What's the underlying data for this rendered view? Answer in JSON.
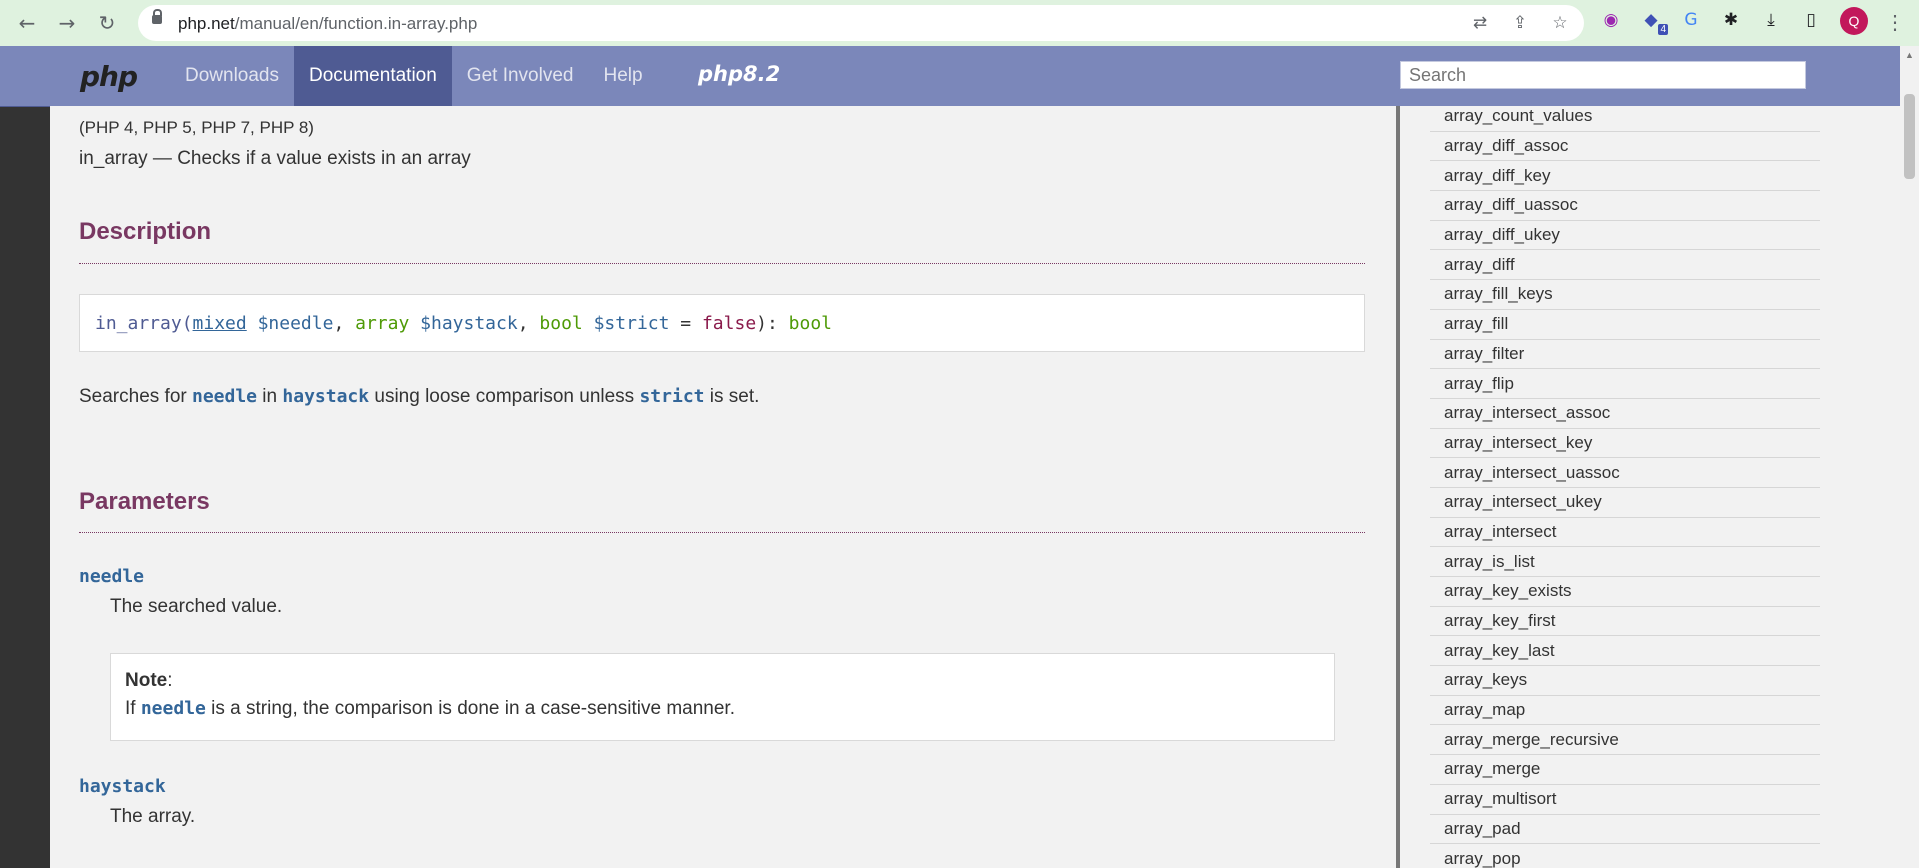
{
  "browser": {
    "url_host": "php.net",
    "url_path": "/manual/en/function.in-array.php",
    "avatar_letter": "Q",
    "extension_badge": "4"
  },
  "navbar": {
    "logo": "php",
    "links": [
      "Downloads",
      "Documentation",
      "Get Involved",
      "Help"
    ],
    "active": "Documentation",
    "release_logo": "php8.2",
    "search_placeholder": "Search"
  },
  "page": {
    "versions": "(PHP 4, PHP 5, PHP 7, PHP 8)",
    "purpose": "in_array — Checks if a value exists in an array",
    "description_heading": "Description",
    "synopsis": {
      "function": "in_array",
      "type1": "mixed",
      "param1": "$needle",
      "type2": "array",
      "param2": "$haystack",
      "type3": "bool",
      "param3": "$strict",
      "default": "false",
      "return_type": "bool"
    },
    "desc_text": {
      "p1": "Searches for ",
      "needle": "needle",
      "p2": " in ",
      "haystack": "haystack",
      "p3": " using loose comparison unless ",
      "strict": "strict",
      "p4": " is set."
    },
    "parameters_heading": "Parameters",
    "param_needle": "needle",
    "param_needle_desc": "The searched value.",
    "note_title": "Note",
    "note_text": {
      "p1": "If ",
      "code": "needle",
      "p2": " is a string, the comparison is done in a case-sensitive manner."
    },
    "param_haystack": "haystack",
    "param_haystack_desc": "The array."
  },
  "sidebar": {
    "items": [
      "array_count_values",
      "array_diff_assoc",
      "array_diff_key",
      "array_diff_uassoc",
      "array_diff_ukey",
      "array_diff",
      "array_fill_keys",
      "array_fill",
      "array_filter",
      "array_flip",
      "array_intersect_assoc",
      "array_intersect_key",
      "array_intersect_uassoc",
      "array_intersect_ukey",
      "array_intersect",
      "array_is_list",
      "array_key_exists",
      "array_key_first",
      "array_key_last",
      "array_keys",
      "array_map",
      "array_merge_recursive",
      "array_merge",
      "array_multisort",
      "array_pad",
      "array_pop"
    ]
  }
}
